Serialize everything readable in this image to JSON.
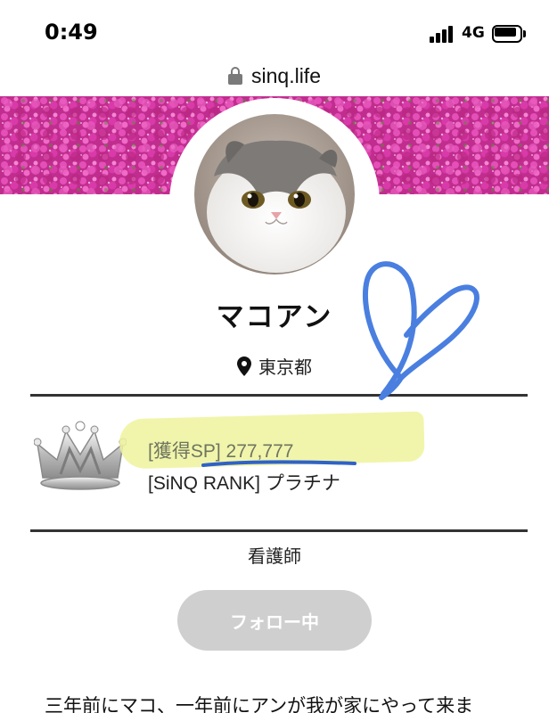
{
  "status_bar": {
    "time": "0:49",
    "network": "4G"
  },
  "browser": {
    "url": "sinq.life"
  },
  "profile": {
    "name": "マコアン",
    "location": "東京都",
    "acquired_sp": "[獲得SP] 277,777",
    "rank": "[SiNQ RANK] プラチナ",
    "occupation": "看護師",
    "follow_label": "フォロー中",
    "bio": "三年前にマコ、一年前にアンが我が家にやって来ま"
  },
  "icons": {
    "signal": "signal-strength-icon",
    "battery": "battery-icon",
    "lock": "lock-icon",
    "location": "location-pin-icon",
    "crown": "crown-icon"
  },
  "colors": {
    "banner_flowers": "#d23aa4",
    "highlight": "#eef39c",
    "pen": "#4a7fe0",
    "follow_button": "#cfcfcf"
  }
}
